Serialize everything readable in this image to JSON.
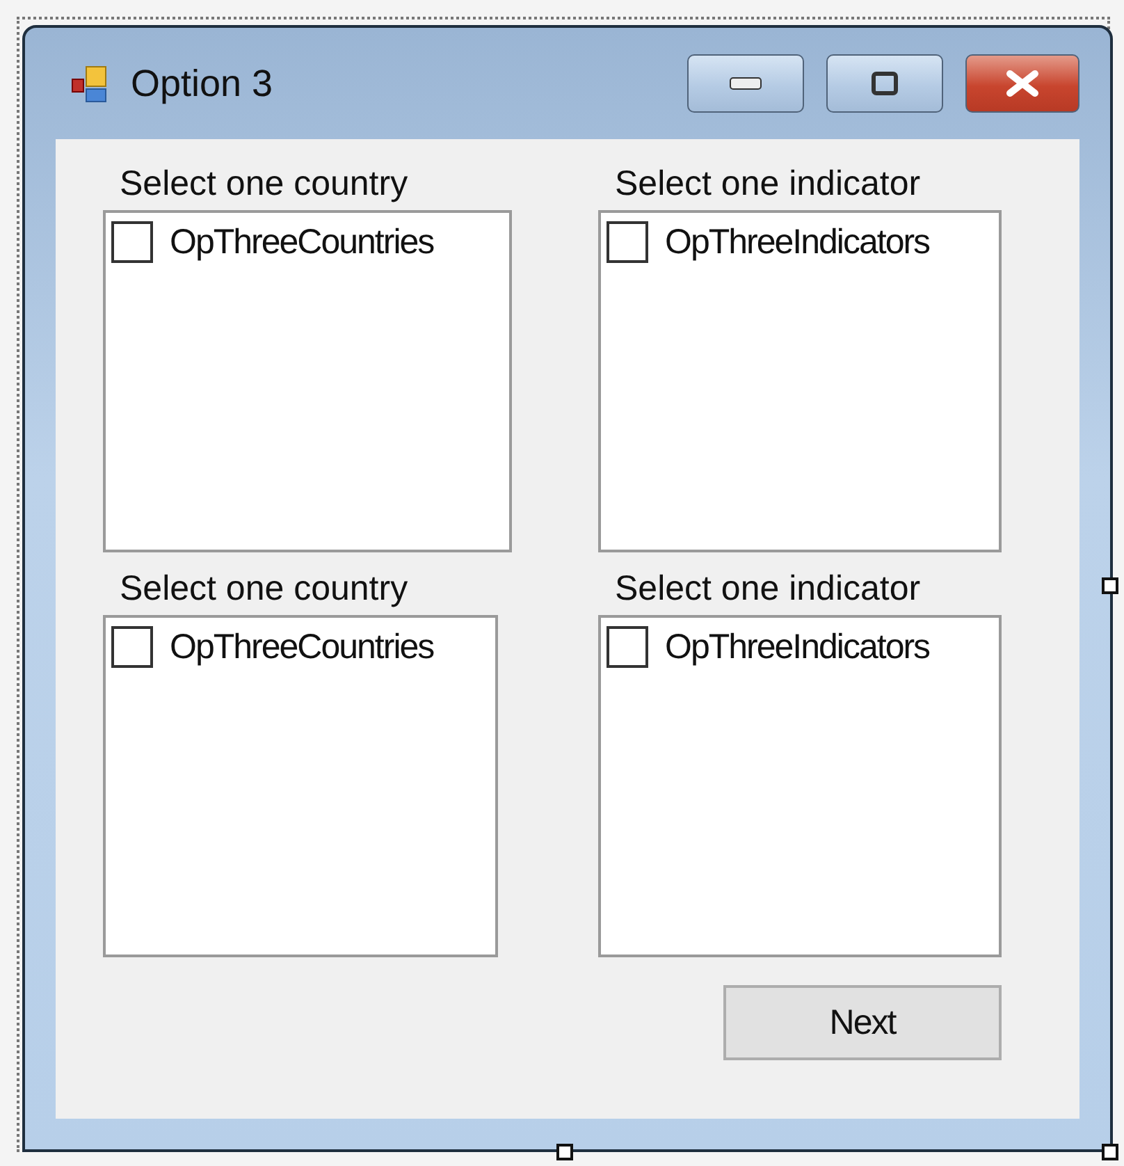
{
  "window": {
    "title": "Option 3"
  },
  "groups": [
    {
      "label": "Select one country",
      "items": [
        {
          "text": "OpThreeCountries",
          "checked": false
        }
      ]
    },
    {
      "label": "Select one indicator",
      "items": [
        {
          "text": "OpThreeIndicators",
          "checked": false
        }
      ]
    },
    {
      "label": "Select one country",
      "items": [
        {
          "text": "OpThreeCountries",
          "checked": false
        }
      ]
    },
    {
      "label": "Select one indicator",
      "items": [
        {
          "text": "OpThreeIndicators",
          "checked": false
        }
      ]
    }
  ],
  "buttons": [
    {
      "label": "Next"
    }
  ]
}
